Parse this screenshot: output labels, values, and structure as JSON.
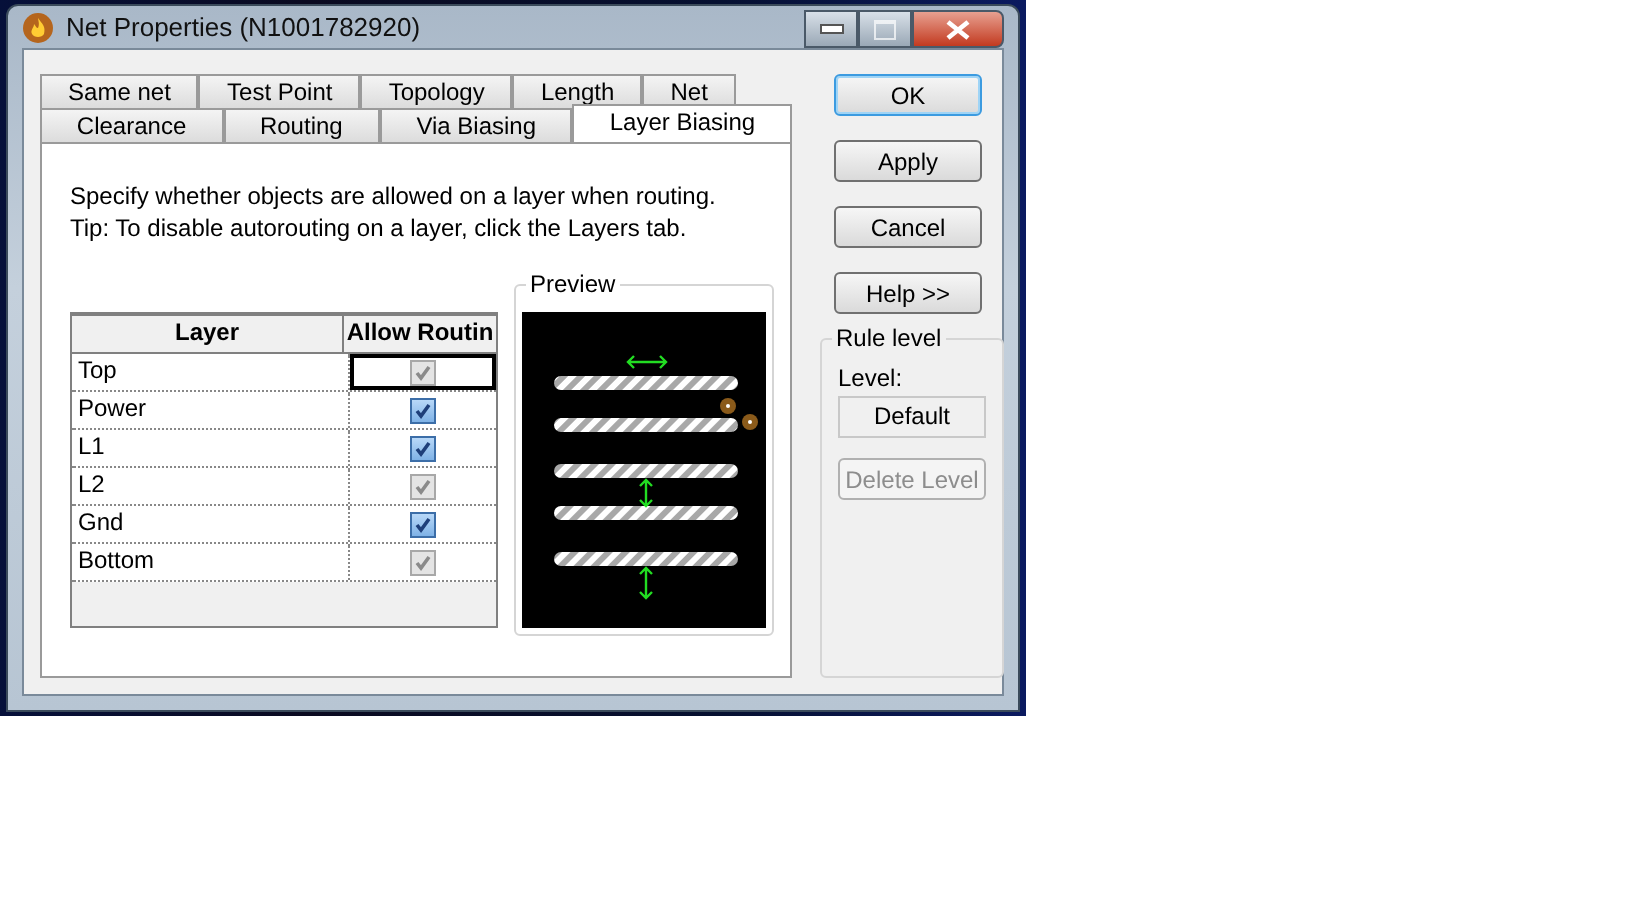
{
  "window": {
    "title": "Net Properties (N1001782920)"
  },
  "tab_rows": [
    {
      "tabs": [
        {
          "label": "Same net",
          "selected": false
        },
        {
          "label": "Test Point",
          "selected": false
        },
        {
          "label": "Topology",
          "selected": false
        },
        {
          "label": "Length",
          "selected": false
        },
        {
          "label": "Net",
          "selected": false
        }
      ]
    },
    {
      "tabs": [
        {
          "label": "Clearance",
          "selected": false
        },
        {
          "label": "Routing",
          "selected": false
        },
        {
          "label": "Via Biasing",
          "selected": false
        },
        {
          "label": "Layer Biasing",
          "selected": true
        }
      ]
    }
  ],
  "description": [
    "Specify whether objects are allowed on a layer when routing.",
    "Tip: To disable autorouting on a layer, click the Layers tab."
  ],
  "layer_table": {
    "columns": [
      "Layer",
      "Allow Routin"
    ],
    "rows": [
      {
        "layer": "Top",
        "checked": true,
        "disabled": true,
        "focused": true
      },
      {
        "layer": "Power",
        "checked": true,
        "disabled": false,
        "focused": false
      },
      {
        "layer": "L1",
        "checked": true,
        "disabled": false,
        "focused": false
      },
      {
        "layer": "L2",
        "checked": true,
        "disabled": true,
        "focused": false
      },
      {
        "layer": "Gnd",
        "checked": true,
        "disabled": false,
        "focused": false
      },
      {
        "layer": "Bottom",
        "checked": true,
        "disabled": true,
        "focused": false
      }
    ]
  },
  "preview": {
    "label": "Preview"
  },
  "buttons": [
    {
      "label": "OK",
      "default": true
    },
    {
      "label": "Apply",
      "default": false
    },
    {
      "label": "Cancel",
      "default": false
    },
    {
      "label": "Help >>",
      "default": false
    }
  ],
  "rule_level": {
    "title": "Rule level",
    "level_label": "Level:",
    "level_value": "Default",
    "delete_button": {
      "label": "Delete Level",
      "disabled": true
    }
  }
}
